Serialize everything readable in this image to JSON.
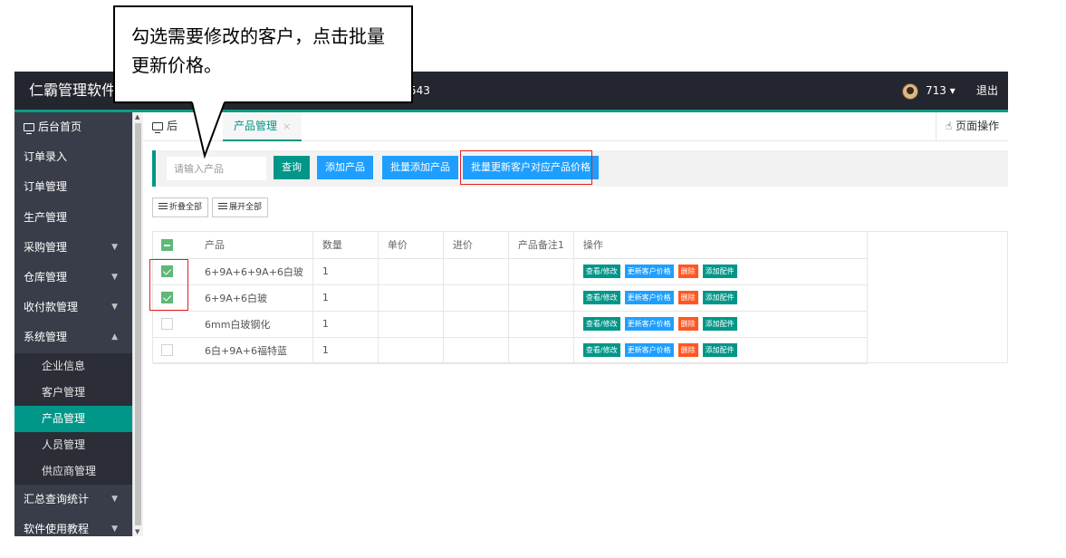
{
  "topbar": {
    "app_title": "仁霸管理软件",
    "number": "543",
    "user": "713 ▾",
    "logout": "退出"
  },
  "sidebar": {
    "items": [
      {
        "label": "后台首页",
        "icon": "monitor-icon"
      },
      {
        "label": "订单录入"
      },
      {
        "label": "订单管理"
      },
      {
        "label": "生产管理"
      },
      {
        "label": "采购管理",
        "arrow": "▼"
      },
      {
        "label": "仓库管理",
        "arrow": "▼"
      },
      {
        "label": "收付款管理",
        "arrow": "▼"
      },
      {
        "label": "系统管理",
        "arrow": "▲"
      }
    ],
    "sub_items": [
      {
        "label": "企业信息"
      },
      {
        "label": "客户管理"
      },
      {
        "label": "产品管理",
        "active": true
      },
      {
        "label": "人员管理"
      },
      {
        "label": "供应商管理"
      }
    ],
    "bottom_items": [
      {
        "label": "汇总查询统计",
        "arrow": "▼"
      },
      {
        "label": "软件使用教程",
        "arrow": "▼"
      }
    ]
  },
  "tabs": {
    "home": "后",
    "active": "产品管理",
    "close": "×",
    "page_ops": "页面操作"
  },
  "search": {
    "placeholder": "请输入产品",
    "query_btn": "查询",
    "add_btn": "添加产品",
    "batch_add_btn": "批量添加产品",
    "batch_update_btn": "批量更新客户对应产品价格"
  },
  "fold": {
    "collapse_all": "折叠全部",
    "expand_all": "展开全部"
  },
  "table": {
    "headers": [
      "产品",
      "数量",
      "单价",
      "进价",
      "产品备注1",
      "操作"
    ],
    "rows": [
      {
        "checked": true,
        "product": "6+9A+6+9A+6白玻",
        "qty": "1",
        "price": "",
        "cost": "",
        "note": ""
      },
      {
        "checked": true,
        "product": "6+9A+6白玻",
        "qty": "1",
        "price": "",
        "cost": "",
        "note": ""
      },
      {
        "checked": false,
        "product": "6mm白玻钢化",
        "qty": "1",
        "price": "",
        "cost": "",
        "note": ""
      },
      {
        "checked": false,
        "product": "6白+9A+6福特蓝",
        "qty": "1",
        "price": "",
        "cost": "",
        "note": ""
      }
    ],
    "ops": {
      "view": "查看/修改",
      "update_price": "更新客户价格",
      "delete": "删除",
      "add_part": "添加配件"
    }
  },
  "callout": {
    "text": "勾选需要修改的客户，点击批量更新价格。"
  },
  "colors": {
    "topbar": "#23262e",
    "sidebar": "#393d49",
    "accent_green": "#009688",
    "blue": "#1e9fff",
    "orange": "#ff5722",
    "check_green": "#5fb878",
    "highlight_red": "#e02020"
  }
}
